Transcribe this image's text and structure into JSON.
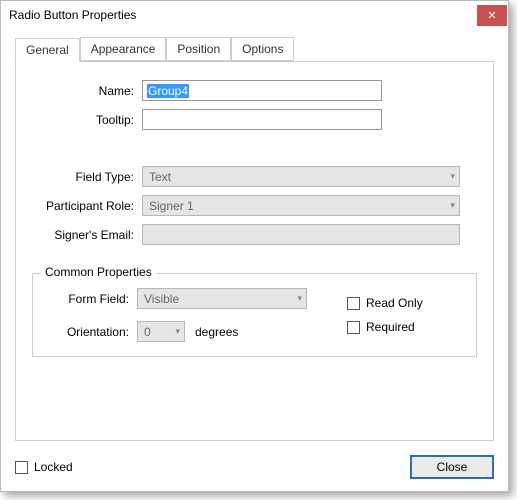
{
  "window": {
    "title": "Radio Button Properties"
  },
  "tabs": {
    "general": "General",
    "appearance": "Appearance",
    "position": "Position",
    "options": "Options"
  },
  "labels": {
    "name": "Name:",
    "tooltip": "Tooltip:",
    "fieldType": "Field Type:",
    "participantRole": "Participant Role:",
    "signersEmail": "Signer's Email:",
    "commonProperties": "Common Properties",
    "formField": "Form Field:",
    "orientation": "Orientation:",
    "degrees": "degrees",
    "readOnly": "Read Only",
    "required": "Required",
    "locked": "Locked",
    "close": "Close"
  },
  "values": {
    "name": "Group4",
    "tooltip": "",
    "fieldType": "Text",
    "participantRole": "Signer 1",
    "signersEmail": "",
    "formField": "Visible",
    "orientation": "0"
  }
}
